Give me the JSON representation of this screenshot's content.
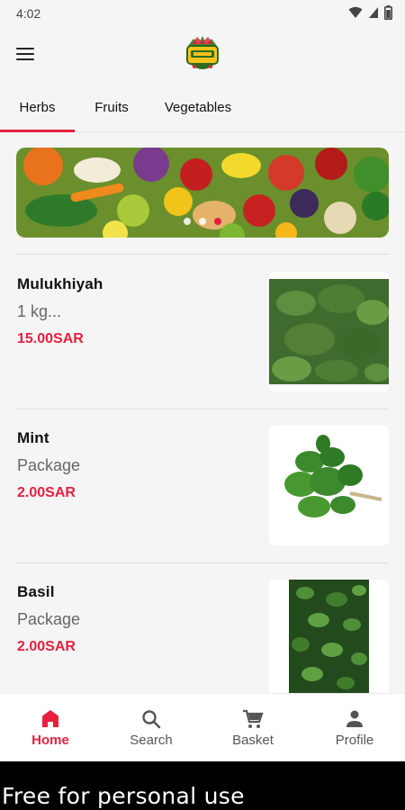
{
  "status_bar": {
    "time": "4:02"
  },
  "app_bar": {
    "logo": "store-logo"
  },
  "tabs": [
    {
      "label": "Herbs",
      "active": true
    },
    {
      "label": "Fruits",
      "active": false
    },
    {
      "label": "Vegetables",
      "active": false
    }
  ],
  "banner": {
    "slides": 3,
    "active_slide": 3
  },
  "products": [
    {
      "name": "Mulukhiyah",
      "unit": "1 kg...",
      "price": "15.00SAR"
    },
    {
      "name": "Mint",
      "unit": "Package",
      "price": "2.00SAR"
    },
    {
      "name": "Basil",
      "unit": "Package",
      "price": "2.00SAR"
    }
  ],
  "bottom_nav": [
    {
      "label": "Home",
      "icon": "home-icon",
      "active": true
    },
    {
      "label": "Search",
      "icon": "search-icon",
      "active": false
    },
    {
      "label": "Basket",
      "icon": "cart-icon",
      "active": false
    },
    {
      "label": "Profile",
      "icon": "person-icon",
      "active": false
    }
  ],
  "footer": {
    "text": "Free for personal use"
  },
  "colors": {
    "accent": "#e5213f",
    "background": "#f5f5f5"
  }
}
